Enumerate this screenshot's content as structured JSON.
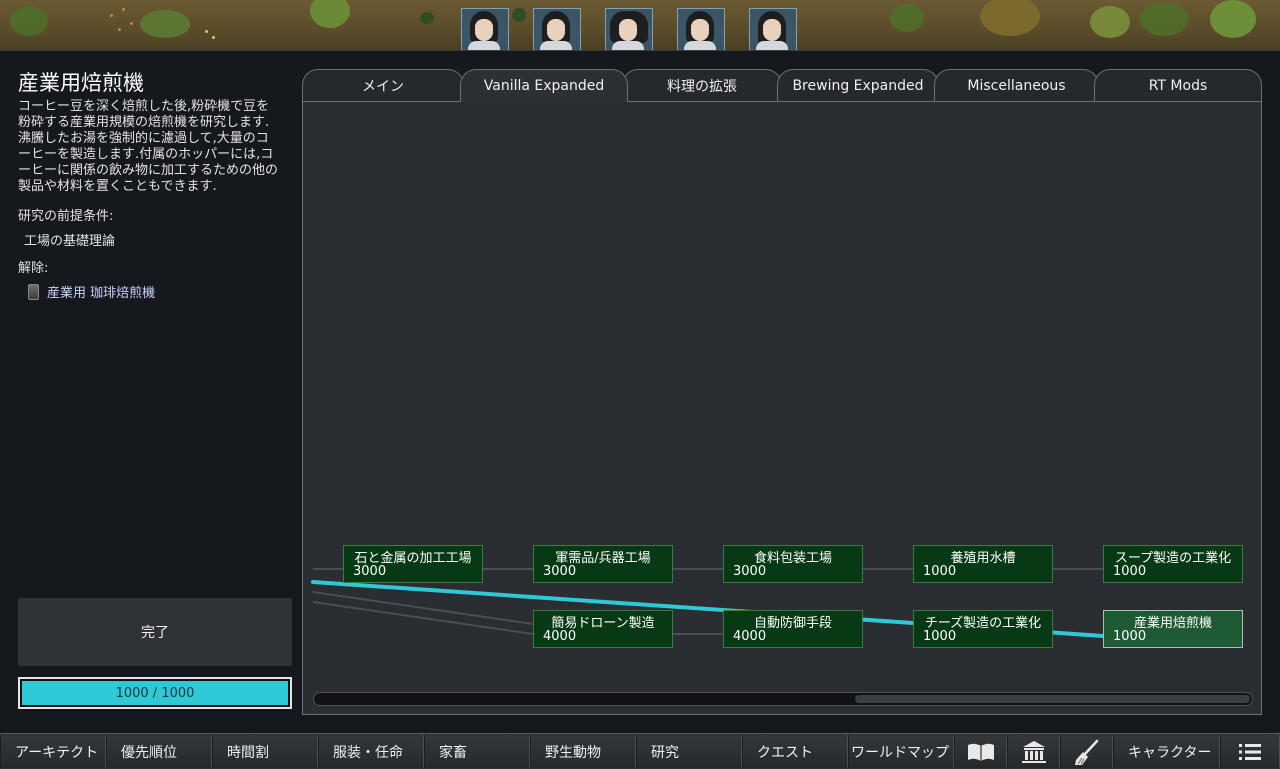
{
  "colonist_bar": {
    "colonists": [
      "colonist-1",
      "colonist-2",
      "colonist-3",
      "colonist-4",
      "colonist-5"
    ]
  },
  "project": {
    "title": "産業用焙煎機",
    "description": "コーヒー豆を深く焙煎した後,粉砕機で豆を粉砕する産業用規模の焙煎機を研究します.沸騰したお湯を強制的に濾過して,大量のコーヒーを製造します.付属のホッパーには,コーヒーに関係の飲み物に加工するための他の製品や材料を置くこともできます.",
    "prereq_label": "研究の前提条件:",
    "prereqs": [
      "工場の基礎理論"
    ],
    "unlocks_label": "解除:",
    "unlocks": [
      {
        "icon": "machine-icon",
        "label": "産業用 珈琲焙煎機"
      }
    ],
    "complete_label": "完了",
    "progress_text": "1000 / 1000",
    "progress_fraction": 1.0,
    "progress_color": "#2ec8d6"
  },
  "tabs": [
    {
      "label": "メイン",
      "active": false
    },
    {
      "label": "Vanilla Expanded",
      "active": true
    },
    {
      "label": "料理の拡張",
      "active": false
    },
    {
      "label": "Brewing Expanded",
      "active": false
    },
    {
      "label": "Miscellaneous",
      "active": false
    },
    {
      "label": "RT Mods",
      "active": false
    }
  ],
  "tree": {
    "nodes": [
      {
        "name": "石と金属の加工工場",
        "cost": "3000"
      },
      {
        "name": "軍需品/兵器工場",
        "cost": "3000"
      },
      {
        "name": "食料包装工場",
        "cost": "3000"
      },
      {
        "name": "養殖用水槽",
        "cost": "1000"
      },
      {
        "name": "スープ製造の工業化",
        "cost": "1000"
      },
      {
        "name": "簡易ドローン製造",
        "cost": "4000"
      },
      {
        "name": "自動防御手段",
        "cost": "4000"
      },
      {
        "name": "チーズ製造の工業化",
        "cost": "1000"
      },
      {
        "name": "産業用焙煎機",
        "cost": "1000",
        "selected": true
      }
    ],
    "highlight_color": "#2ec8d6",
    "node_color": "#073a14"
  },
  "bottom_bar": {
    "buttons": [
      {
        "label": "アーキテクト"
      },
      {
        "label": "優先順位"
      },
      {
        "label": "時間割"
      },
      {
        "label": "服装・任命"
      },
      {
        "label": "家畜"
      },
      {
        "label": "野生動物"
      },
      {
        "label": "研究"
      },
      {
        "label": "クエスト"
      },
      {
        "label": "ワールドマップ"
      },
      {
        "icon": "book-icon"
      },
      {
        "icon": "faction-building-icon"
      },
      {
        "icon": "broom-icon"
      },
      {
        "label": "キャラクター"
      },
      {
        "icon": "menu-list-icon"
      }
    ]
  }
}
